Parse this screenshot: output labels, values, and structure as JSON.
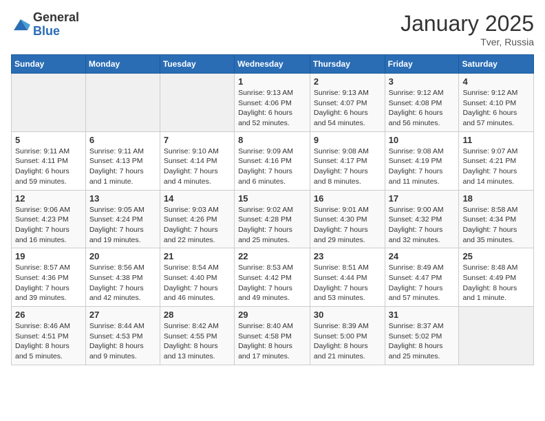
{
  "logo": {
    "general": "General",
    "blue": "Blue"
  },
  "header": {
    "month": "January 2025",
    "location": "Tver, Russia"
  },
  "weekdays": [
    "Sunday",
    "Monday",
    "Tuesday",
    "Wednesday",
    "Thursday",
    "Friday",
    "Saturday"
  ],
  "weeks": [
    [
      {
        "day": "",
        "info": ""
      },
      {
        "day": "",
        "info": ""
      },
      {
        "day": "",
        "info": ""
      },
      {
        "day": "1",
        "info": "Sunrise: 9:13 AM\nSunset: 4:06 PM\nDaylight: 6 hours and 52 minutes."
      },
      {
        "day": "2",
        "info": "Sunrise: 9:13 AM\nSunset: 4:07 PM\nDaylight: 6 hours and 54 minutes."
      },
      {
        "day": "3",
        "info": "Sunrise: 9:12 AM\nSunset: 4:08 PM\nDaylight: 6 hours and 56 minutes."
      },
      {
        "day": "4",
        "info": "Sunrise: 9:12 AM\nSunset: 4:10 PM\nDaylight: 6 hours and 57 minutes."
      }
    ],
    [
      {
        "day": "5",
        "info": "Sunrise: 9:11 AM\nSunset: 4:11 PM\nDaylight: 6 hours and 59 minutes."
      },
      {
        "day": "6",
        "info": "Sunrise: 9:11 AM\nSunset: 4:13 PM\nDaylight: 7 hours and 1 minute."
      },
      {
        "day": "7",
        "info": "Sunrise: 9:10 AM\nSunset: 4:14 PM\nDaylight: 7 hours and 4 minutes."
      },
      {
        "day": "8",
        "info": "Sunrise: 9:09 AM\nSunset: 4:16 PM\nDaylight: 7 hours and 6 minutes."
      },
      {
        "day": "9",
        "info": "Sunrise: 9:08 AM\nSunset: 4:17 PM\nDaylight: 7 hours and 8 minutes."
      },
      {
        "day": "10",
        "info": "Sunrise: 9:08 AM\nSunset: 4:19 PM\nDaylight: 7 hours and 11 minutes."
      },
      {
        "day": "11",
        "info": "Sunrise: 9:07 AM\nSunset: 4:21 PM\nDaylight: 7 hours and 14 minutes."
      }
    ],
    [
      {
        "day": "12",
        "info": "Sunrise: 9:06 AM\nSunset: 4:23 PM\nDaylight: 7 hours and 16 minutes."
      },
      {
        "day": "13",
        "info": "Sunrise: 9:05 AM\nSunset: 4:24 PM\nDaylight: 7 hours and 19 minutes."
      },
      {
        "day": "14",
        "info": "Sunrise: 9:03 AM\nSunset: 4:26 PM\nDaylight: 7 hours and 22 minutes."
      },
      {
        "day": "15",
        "info": "Sunrise: 9:02 AM\nSunset: 4:28 PM\nDaylight: 7 hours and 25 minutes."
      },
      {
        "day": "16",
        "info": "Sunrise: 9:01 AM\nSunset: 4:30 PM\nDaylight: 7 hours and 29 minutes."
      },
      {
        "day": "17",
        "info": "Sunrise: 9:00 AM\nSunset: 4:32 PM\nDaylight: 7 hours and 32 minutes."
      },
      {
        "day": "18",
        "info": "Sunrise: 8:58 AM\nSunset: 4:34 PM\nDaylight: 7 hours and 35 minutes."
      }
    ],
    [
      {
        "day": "19",
        "info": "Sunrise: 8:57 AM\nSunset: 4:36 PM\nDaylight: 7 hours and 39 minutes."
      },
      {
        "day": "20",
        "info": "Sunrise: 8:56 AM\nSunset: 4:38 PM\nDaylight: 7 hours and 42 minutes."
      },
      {
        "day": "21",
        "info": "Sunrise: 8:54 AM\nSunset: 4:40 PM\nDaylight: 7 hours and 46 minutes."
      },
      {
        "day": "22",
        "info": "Sunrise: 8:53 AM\nSunset: 4:42 PM\nDaylight: 7 hours and 49 minutes."
      },
      {
        "day": "23",
        "info": "Sunrise: 8:51 AM\nSunset: 4:44 PM\nDaylight: 7 hours and 53 minutes."
      },
      {
        "day": "24",
        "info": "Sunrise: 8:49 AM\nSunset: 4:47 PM\nDaylight: 7 hours and 57 minutes."
      },
      {
        "day": "25",
        "info": "Sunrise: 8:48 AM\nSunset: 4:49 PM\nDaylight: 8 hours and 1 minute."
      }
    ],
    [
      {
        "day": "26",
        "info": "Sunrise: 8:46 AM\nSunset: 4:51 PM\nDaylight: 8 hours and 5 minutes."
      },
      {
        "day": "27",
        "info": "Sunrise: 8:44 AM\nSunset: 4:53 PM\nDaylight: 8 hours and 9 minutes."
      },
      {
        "day": "28",
        "info": "Sunrise: 8:42 AM\nSunset: 4:55 PM\nDaylight: 8 hours and 13 minutes."
      },
      {
        "day": "29",
        "info": "Sunrise: 8:40 AM\nSunset: 4:58 PM\nDaylight: 8 hours and 17 minutes."
      },
      {
        "day": "30",
        "info": "Sunrise: 8:39 AM\nSunset: 5:00 PM\nDaylight: 8 hours and 21 minutes."
      },
      {
        "day": "31",
        "info": "Sunrise: 8:37 AM\nSunset: 5:02 PM\nDaylight: 8 hours and 25 minutes."
      },
      {
        "day": "",
        "info": ""
      }
    ]
  ]
}
